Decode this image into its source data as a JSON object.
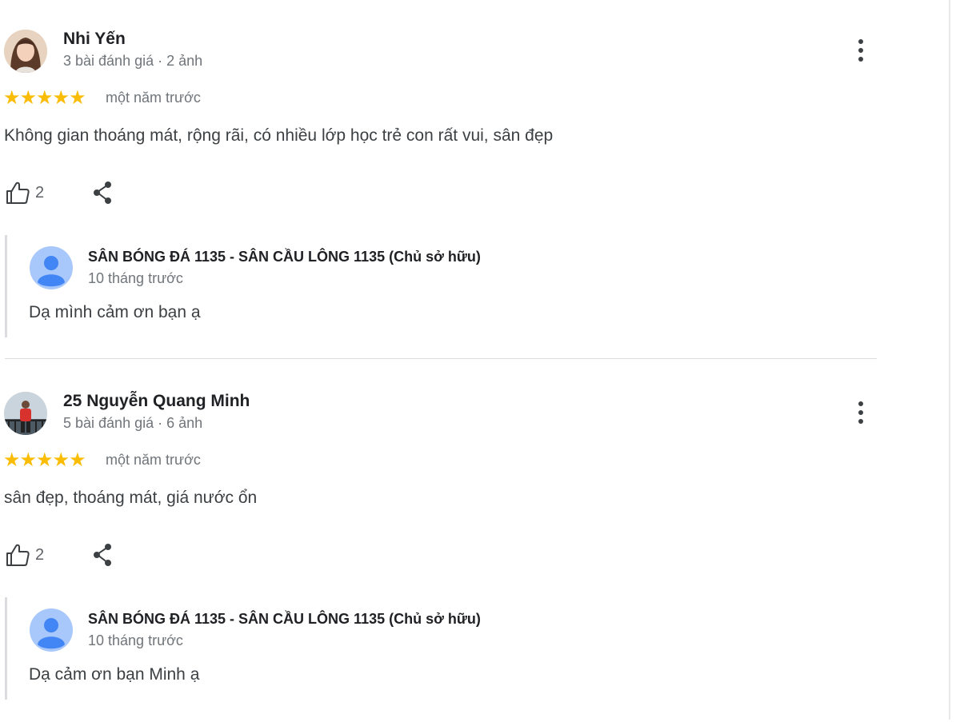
{
  "reviews": [
    {
      "author": "Nhi Yến",
      "meta": "3 bài đánh giá · 2 ảnh",
      "rating_stars": 5,
      "stars": "★★★★★",
      "date": "một năm trước",
      "text": "Không gian thoáng mát, rộng rãi, có nhiều lớp học trẻ con rất vui, sân đẹp",
      "likes": "2",
      "reply": {
        "owner": "SÂN BÓNG ĐÁ 1135 - SÂN CẦU LÔNG 1135 (Chủ sở hữu)",
        "date": "10 tháng trước",
        "text": "Dạ mình cảm ơn bạn ạ"
      }
    },
    {
      "author": "25 Nguyễn Quang Minh",
      "meta": "5 bài đánh giá · 6 ảnh",
      "rating_stars": 5,
      "stars": "★★★★★",
      "date": "một năm trước",
      "text": "sân đẹp, thoáng mát, giá nước ổn",
      "likes": "2",
      "reply": {
        "owner": "SÂN BÓNG ĐÁ 1135 - SÂN CẦU LÔNG 1135 (Chủ sở hữu)",
        "date": "10 tháng trước",
        "text": "Dạ cảm ơn bạn Minh ạ"
      }
    }
  ],
  "colors": {
    "star": "#fbbc04",
    "owner_avatar": "#4285f4",
    "owner_avatar_bg": "#a8c7fa"
  },
  "icons": [
    "more-vertical-icon",
    "thumbs-up-icon",
    "share-icon",
    "default-avatar-icon"
  ]
}
